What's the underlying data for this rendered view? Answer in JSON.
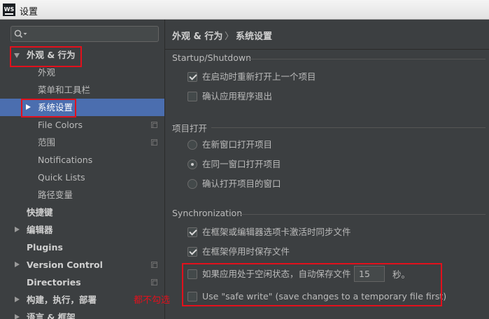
{
  "window": {
    "title": "设置",
    "app_badge": "WS"
  },
  "sidebar": {
    "search_placeholder": "",
    "items": [
      {
        "label": "外观 & 行为"
      },
      {
        "label": "外观"
      },
      {
        "label": "菜单和工具栏"
      },
      {
        "label": "系统设置"
      },
      {
        "label": "File Colors"
      },
      {
        "label": "范围"
      },
      {
        "label": "Notifications"
      },
      {
        "label": "Quick Lists"
      },
      {
        "label": "路径变量"
      },
      {
        "label": "快捷键"
      },
      {
        "label": "编辑器"
      },
      {
        "label": "Plugins"
      },
      {
        "label": "Version Control"
      },
      {
        "label": "Directories"
      },
      {
        "label": "构建，执行，部署"
      },
      {
        "label": "语言 & 框架"
      }
    ],
    "selected": "系统设置"
  },
  "breadcrumb": {
    "parent": "外观 & 行为",
    "separator": "〉",
    "current": "系统设置"
  },
  "sections": {
    "startup": {
      "title": "Startup/Shutdown",
      "options": [
        {
          "label": "在启动时重新打开上一个项目",
          "checked": true
        },
        {
          "label": "确认应用程序退出",
          "checked": false
        }
      ]
    },
    "project_open": {
      "title": "项目打开",
      "options": [
        {
          "label": "在新窗口打开项目",
          "selected": false
        },
        {
          "label": "在同一窗口打开项目",
          "selected": true
        },
        {
          "label": "确认打开项目的窗口",
          "selected": false
        }
      ]
    },
    "sync": {
      "title": "Synchronization",
      "options": [
        {
          "label": "在框架或编辑器选项卡激活时同步文件",
          "checked": true
        },
        {
          "label": "在框架停用时保存文件",
          "checked": true
        },
        {
          "label": "如果应用处于空闲状态，自动保存文件",
          "checked": false
        },
        {
          "label": "Use \"safe write\" (save changes to a temporary file first)",
          "checked": false
        }
      ],
      "idle_seconds": "15",
      "idle_unit": "秒。"
    }
  },
  "annotation": {
    "note": "都不勾选",
    "color": "#e2101c"
  },
  "colors": {
    "background": "#3c3f41",
    "selection": "#4b6eaf",
    "text": "#bbbbbb"
  }
}
